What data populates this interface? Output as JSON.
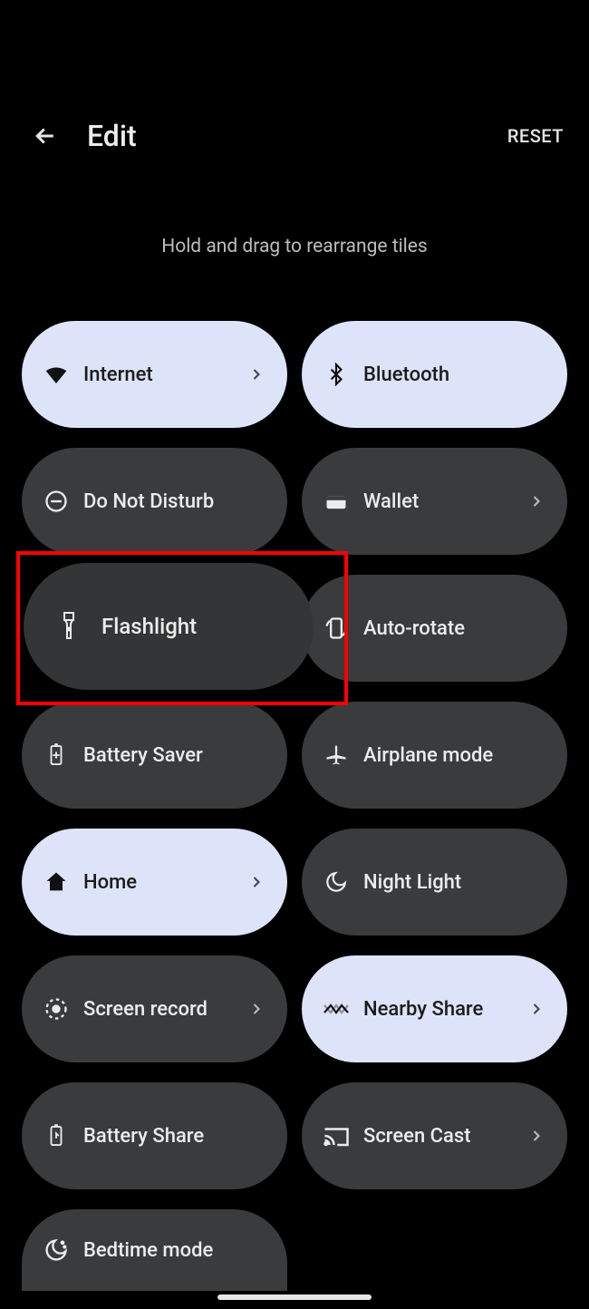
{
  "header": {
    "title": "Edit",
    "reset_label": "RESET"
  },
  "instruction": "Hold and drag to rearrange tiles",
  "tiles": {
    "internet": {
      "label": "Internet"
    },
    "bluetooth": {
      "label": "Bluetooth"
    },
    "dnd": {
      "label": "Do Not Disturb"
    },
    "wallet": {
      "label": "Wallet"
    },
    "flashlight": {
      "label": "Flashlight"
    },
    "autorotate": {
      "label": "Auto-rotate"
    },
    "batterysaver": {
      "label": "Battery Saver"
    },
    "airplane": {
      "label": "Airplane mode"
    },
    "home": {
      "label": "Home"
    },
    "nightlight": {
      "label": "Night Light"
    },
    "screenrecord": {
      "label": "Screen record"
    },
    "nearbyshare": {
      "label": "Nearby Share"
    },
    "batteryshare": {
      "label": "Battery Share"
    },
    "screencast": {
      "label": "Screen Cast"
    },
    "bedtime": {
      "label": "Bedtime mode"
    }
  },
  "colors": {
    "active_bg": "#dde3f8",
    "inactive_bg": "#393b3d",
    "highlight_border": "#ff0000"
  }
}
